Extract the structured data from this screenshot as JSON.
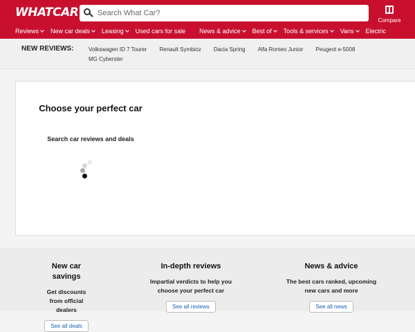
{
  "header": {
    "logo": "WHATCAR?",
    "search_placeholder": "Search What Car?",
    "compare_label": "Compare",
    "brand_color": "#c8102e"
  },
  "nav": {
    "items": [
      {
        "label": "Reviews",
        "dropdown": true
      },
      {
        "label": "New car deals",
        "dropdown": true
      },
      {
        "label": "Leasing",
        "dropdown": true
      },
      {
        "label": "Used cars for sale",
        "dropdown": false
      },
      {
        "label": "News & advice",
        "dropdown": true
      },
      {
        "label": "Best of",
        "dropdown": true
      },
      {
        "label": "Tools & services",
        "dropdown": true
      },
      {
        "label": "Vans",
        "dropdown": true
      },
      {
        "label": "Electric",
        "dropdown": false
      }
    ]
  },
  "new_reviews": {
    "label": "NEW REVIEWS:",
    "links": [
      "Volkswagen ID 7 Tourer",
      "Renault Symbioz",
      "Dacia Spring",
      "Alfa Romeo Junior",
      "Peugeot e-5008",
      "MG Cyberster"
    ]
  },
  "finder": {
    "title": "Choose your perfect car",
    "subtitle": "Search car reviews and deals"
  },
  "features": [
    {
      "title": "New car savings",
      "desc": "Get discounts from official dealers",
      "link": "See all deals"
    },
    {
      "title": "In-depth reviews",
      "desc": "Impartial verdicts to help you choose your perfect car",
      "link": "See all reviews"
    },
    {
      "title": "News & advice",
      "desc": "The best cars ranked, upcoming new cars and more",
      "link": "See all news"
    }
  ]
}
